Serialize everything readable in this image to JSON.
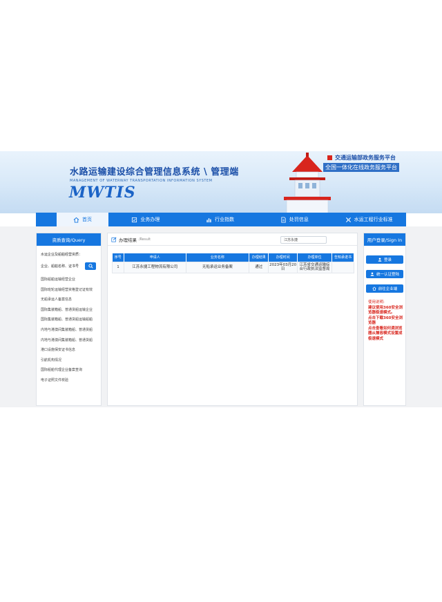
{
  "header": {
    "title_cn": "水路运输建设综合管理信息系统 \\ 管理端",
    "title_en": "MANAGEMENT OF WATERWAY TRANSPORTATION INFORMATION SYSTEM",
    "logo": "MWTIS",
    "platform_line1": "交通运输部政务服务平台",
    "platform_line2": "全国一体化在线政务服务平台"
  },
  "nav": {
    "items": [
      {
        "label": "首页",
        "icon": "home-icon"
      },
      {
        "label": "业务办理",
        "icon": "checklist-icon"
      },
      {
        "label": "行业指数",
        "icon": "bar-chart-icon"
      },
      {
        "label": "处罚信息",
        "icon": "document-icon"
      },
      {
        "label": "水运工程行业标准",
        "icon": "tools-icon"
      }
    ]
  },
  "left_panel": {
    "title": "资质查询/Query",
    "label": "水运企业及船舶经营资质：",
    "search_value": "企业、船舶名称、证书号",
    "links": [
      "国际船舶运输经营企业",
      "国际班轮运输经营资格登记证有效",
      "无船承运人备案信息",
      "国际集装箱船、普通货船运输企业",
      "国际集装箱船、普通货船运输船舶",
      "内地与港澳间集装箱船、普通货船",
      "内地与港澳间集装箱船、普通货船",
      "港口设施保安证书信息",
      "引航机构情况",
      "国际船舶代理企业备案查询",
      "电子证照文件校验"
    ]
  },
  "result": {
    "title": "办理结果",
    "subtitle": "/Result",
    "query_value": "江苏永捷",
    "columns": [
      "序号",
      "申请人",
      "业务名称",
      "办理结果",
      "办理时间",
      "办理单位",
      "告知承诺书"
    ],
    "rows": [
      {
        "no": "1",
        "applicant": "江苏永捷工程物流有限公司",
        "business": "无船承运业务备案",
        "result": "通过",
        "time": "2023年03月20日",
        "unit": "江苏省交通运输综合行政执法监督局",
        "letter": ""
      }
    ]
  },
  "right_panel": {
    "title": "用户登录/Sign In",
    "buttons": [
      {
        "label": "登录",
        "icon": "user-icon"
      },
      {
        "label": "统一认证登陆",
        "icon": "user-icon"
      },
      {
        "label": "前往企业端",
        "icon": "home-icon"
      }
    ],
    "notes_title": "使用说明:",
    "notes": [
      "建议使用360安全浏览器极速模式。",
      "点击下载360安全浏览器",
      "点击查看如何调浏览器从兼容模式设置成极速模式"
    ]
  },
  "colors": {
    "primary": "#1677e0",
    "dark_blue": "#1b4fa8",
    "alert_red": "#d8251d"
  }
}
